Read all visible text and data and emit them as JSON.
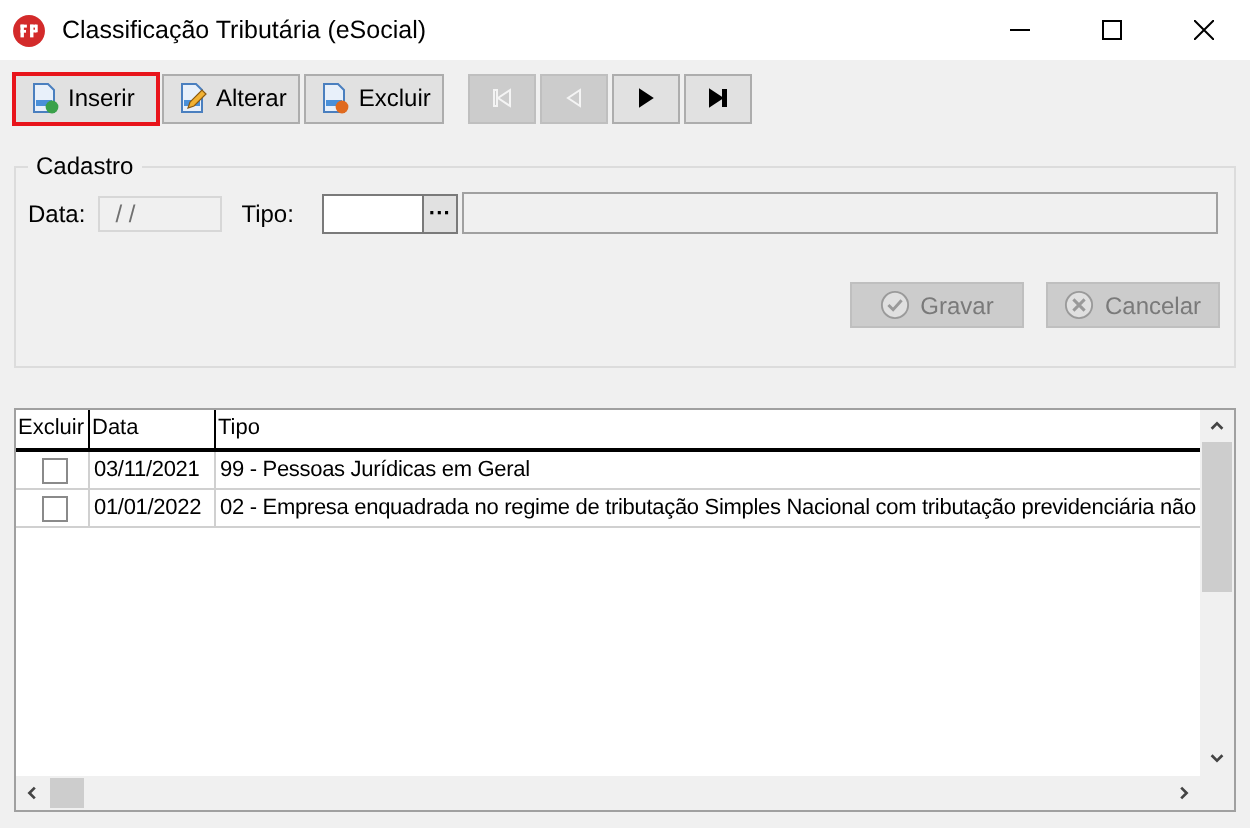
{
  "window": {
    "title": "Classificação Tributária (eSocial)"
  },
  "toolbar": {
    "buttons": [
      {
        "label": "Inserir",
        "kind": "insert",
        "focused": true
      },
      {
        "label": "Alterar",
        "kind": "edit",
        "focused": false
      },
      {
        "label": "Excluir",
        "kind": "delete",
        "focused": false
      }
    ],
    "navigation": [
      {
        "kind": "first",
        "disabled": true
      },
      {
        "kind": "previous",
        "disabled": true
      },
      {
        "kind": "next",
        "disabled": false
      },
      {
        "kind": "last",
        "disabled": false
      }
    ]
  },
  "cadastro": {
    "title": "Cadastro",
    "data_label": "Data:",
    "data_value": "/ /",
    "tipo_label": "Tipo:",
    "lookup_button": "···",
    "actions": [
      {
        "label": "Gravar",
        "kind": "save",
        "disabled": true
      },
      {
        "label": "Cancelar",
        "kind": "cancel",
        "disabled": true
      }
    ]
  },
  "table": {
    "columns": [
      "Excluir",
      "Data",
      "Tipo"
    ],
    "rows": [
      {
        "checked": false,
        "data": "03/11/2021",
        "tipo": "99 - Pessoas Jurídicas em Geral"
      },
      {
        "checked": false,
        "data": "01/01/2022",
        "tipo": "02 - Empresa enquadrada no regime de tributação Simples Nacional com tributação previdenciária não"
      }
    ]
  }
}
